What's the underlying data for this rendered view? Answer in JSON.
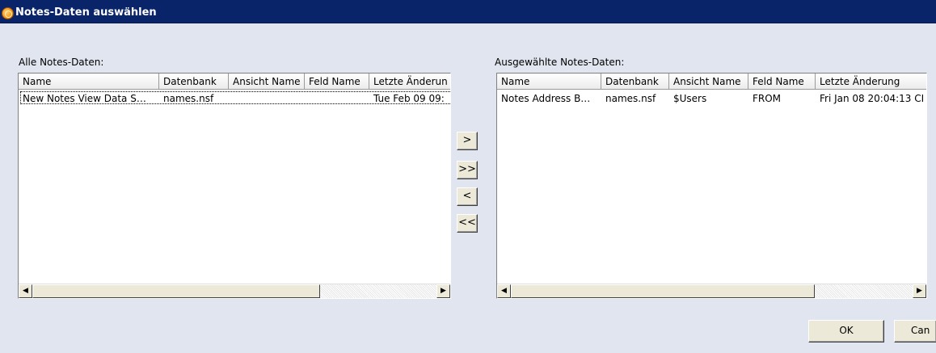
{
  "window": {
    "title": "Notes-Daten auswählen",
    "icon": "lotus-notes-icon"
  },
  "left_panel": {
    "label": "Alle Notes-Daten:",
    "columns": [
      "Name",
      "Datenbank",
      "Ansicht Name",
      "Feld Name",
      "Letzte Änderun"
    ],
    "rows": [
      [
        "New Notes View Data S…",
        "names.nsf",
        "",
        "",
        "Tue Feb 09 09:"
      ]
    ]
  },
  "right_panel": {
    "label": "Ausgewählte Notes-Daten:",
    "columns": [
      "Name",
      "Datenbank",
      "Ansicht Name",
      "Feld Name",
      "Letzte Änderung"
    ],
    "rows": [
      [
        "Notes Address B…",
        "names.nsf",
        "$Users",
        "FROM",
        "Fri Jan 08 20:04:13 CI"
      ]
    ]
  },
  "move_buttons": {
    "add": ">",
    "add_all": ">>",
    "remove": "<",
    "remove_all": "<<"
  },
  "scrollbar": {
    "left_arrow": "◀",
    "right_arrow": "▶"
  },
  "footer": {
    "ok_label": "OK",
    "cancel_label": "Can"
  },
  "colors": {
    "titlebar": "#0a246a",
    "dialog_bg": "#e1e5ef",
    "button_face": "#ece9d8"
  }
}
